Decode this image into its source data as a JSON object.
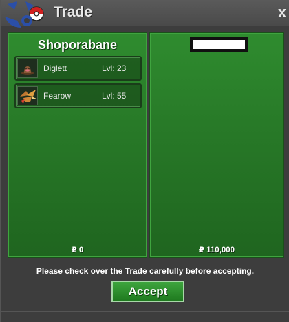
{
  "window": {
    "title": "Trade",
    "close_label": "x"
  },
  "left_panel": {
    "trader_name": "Shoporabane",
    "pokemon": [
      {
        "name": "Diglett",
        "level": "Lvl: 23",
        "icon": "diglett-icon"
      },
      {
        "name": "Fearow",
        "level": "Lvl: 55",
        "icon": "fearow-icon"
      }
    ],
    "money": "₽ 0"
  },
  "right_panel": {
    "trader_name": "",
    "money": "₽ 110,000"
  },
  "footer": {
    "notice": "Please check over the Trade carefully before accepting.",
    "accept_label": "Accept"
  },
  "colors": {
    "panel_green": "#2f8c2f",
    "button_green": "#3ea53e",
    "window_bg": "#3d3d3d"
  }
}
